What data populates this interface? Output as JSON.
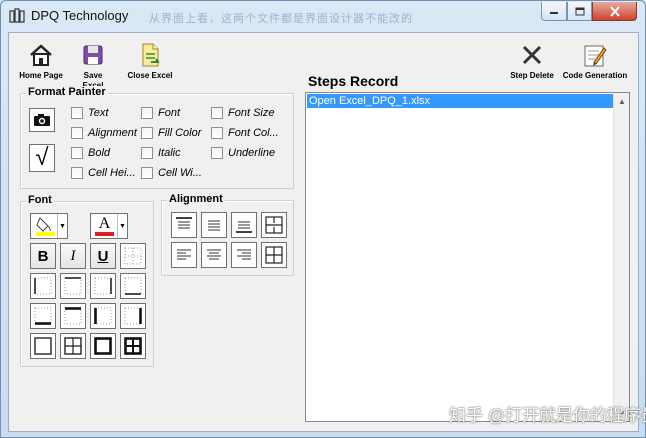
{
  "window": {
    "title": "DPQ Technology",
    "ghost_title": "从界面上看，这两个文件都是界面设计器不能改的"
  },
  "toolbar": {
    "home_label": "Home Page",
    "save_excel_label": "Save Excel",
    "close_excel_label": "Close Excel",
    "step_delete_label": "Step Delete",
    "code_generation_label": "Code Generation"
  },
  "format_painter": {
    "title": "Format Painter",
    "check_mark": "√",
    "options": [
      "Text",
      "Font",
      "Font Size",
      "Alignment",
      "Fill Color",
      "Font Col...",
      "Bold",
      "Italic",
      "Underline",
      "Cell Hei...",
      "Cell Wi..."
    ]
  },
  "font_group": {
    "title": "Font",
    "bold": "B",
    "italic": "I",
    "underline": "U",
    "font_color_letter": "A"
  },
  "alignment_group": {
    "title": "Alignment"
  },
  "steps": {
    "title": "Steps Record",
    "items": [
      "Open Excel_DPQ_1.xlsx"
    ]
  },
  "watermark": "知乎 @打开就是你的程序员",
  "colors": {
    "selection": "#3399ff",
    "fill_yellow": "#ffff00",
    "font_red": "#e02020",
    "close_red": "#c9452d"
  }
}
